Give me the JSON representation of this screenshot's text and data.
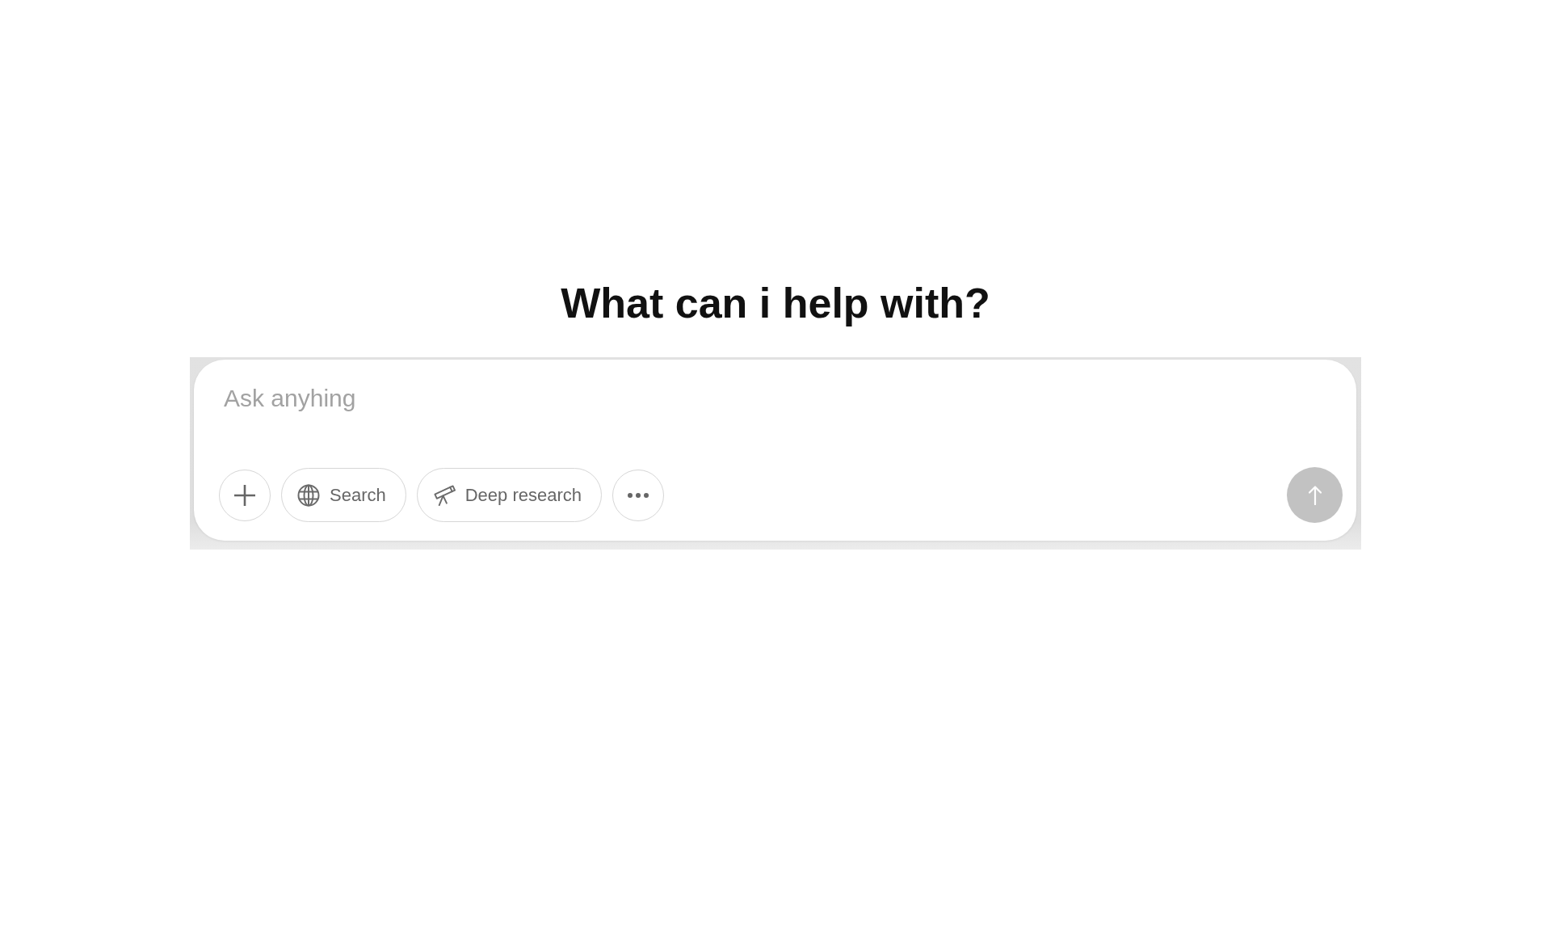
{
  "heading": "What can i help with?",
  "composer": {
    "input": {
      "placeholder": "Ask anyhing"
    },
    "tools": [
      {
        "kind": "add"
      },
      {
        "kind": "search",
        "label": "Search"
      },
      {
        "kind": "research",
        "label": "Deep research"
      },
      {
        "kind": "more"
      }
    ],
    "send_button": {
      "disabled": true
    }
  }
}
